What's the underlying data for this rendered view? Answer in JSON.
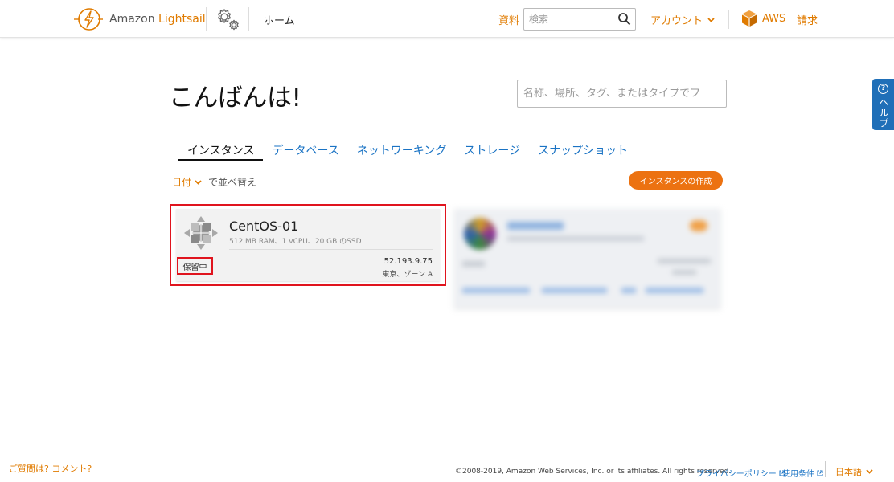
{
  "header": {
    "brand_prefix": "Amazon",
    "brand_name": "Lightsail",
    "home_label": "ホーム",
    "docs_label": "資料",
    "search_placeholder": "検索",
    "account_label": "アカウント",
    "aws_label": "AWS",
    "billing_label": "請求"
  },
  "help_tab": {
    "label": "ヘルプ",
    "icon": "question-circle-icon"
  },
  "main": {
    "greeting": "こんばんは!",
    "search_placeholder": "名称、場所、タグ、またはタイプでフ",
    "tabs": [
      {
        "label": "インスタンス",
        "active": true
      },
      {
        "label": "データベース",
        "active": false
      },
      {
        "label": "ネットワーキング",
        "active": false
      },
      {
        "label": "ストレージ",
        "active": false
      },
      {
        "label": "スナップショット",
        "active": false
      }
    ],
    "sort_key": "日付",
    "sort_suffix": "で並べ替え",
    "create_button": "インスタンスの作成"
  },
  "instance": {
    "name": "CentOS-01",
    "spec": "512 MB RAM、1 vCPU、20 GB のSSD",
    "status": "保留中",
    "ip": "52.193.9.75",
    "zone": "東京、ゾーン A",
    "os_icon": "centos-icon"
  },
  "footer": {
    "feedback": "ご質問は? コメント?",
    "copyright": "©2008-2019, Amazon Web Services, Inc. or its affiliates. All rights reserved.",
    "privacy": "プライバシーポリシー",
    "terms": "使用条件",
    "language": "日本語"
  },
  "colors": {
    "accent": "#e07b00",
    "link": "#1a73c4",
    "highlight": "#e0141e",
    "button": "#ec7211"
  }
}
